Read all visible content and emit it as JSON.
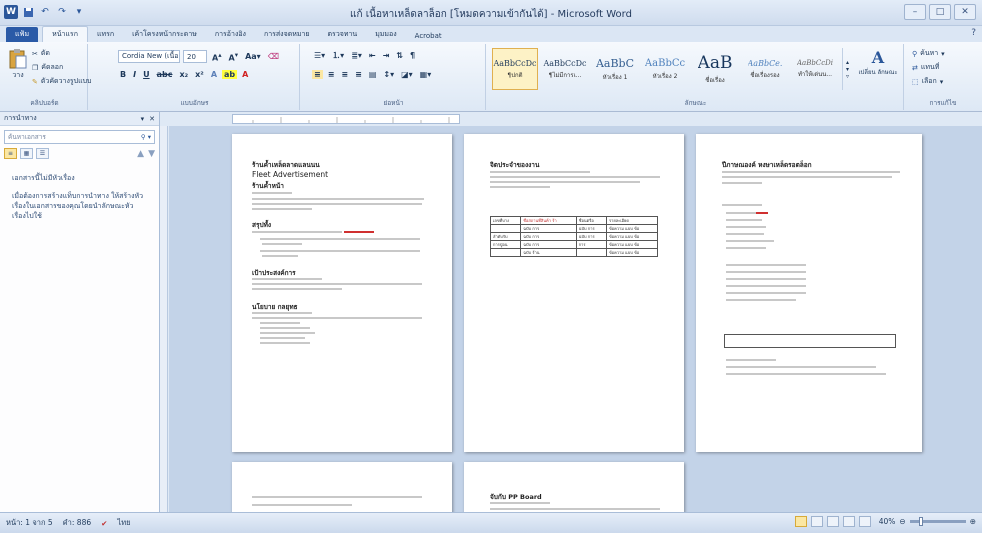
{
  "window": {
    "title": "แก้ เนื้อหาเหล็ดลาล็อก [โหมดความเข้ากันได้] - Microsoft Word",
    "controls": [
      "–",
      "□",
      "✕"
    ]
  },
  "qat": {
    "word_icon": "W",
    "save_icon": "save-icon",
    "undo_icon": "undo-icon",
    "redo_icon": "redo-icon"
  },
  "tabs": [
    "แฟ้ม",
    "หน้าแรก",
    "แทรก",
    "เค้าโครงหน้ากระดาษ",
    "การอ้างอิง",
    "การส่งจดหมาย",
    "ตรวจทาน",
    "มุมมอง",
    "Acrobat"
  ],
  "ribbon": {
    "clipboard": {
      "label": "คลิปบอร์ด",
      "paste": "วาง",
      "cut": "ตัด",
      "copy": "คัดลอก",
      "format_painter": "ตัวคัดวางรูปแบบ"
    },
    "font": {
      "label": "แบบอักษร",
      "font_name": "Cordia New (เนื้อ",
      "font_size": "20"
    },
    "paragraph": {
      "label": "ย่อหน้า"
    },
    "styles": {
      "label": "ลักษณะ",
      "items": [
        {
          "sample": "AaBbCcDc",
          "name": "¶ปกติ"
        },
        {
          "sample": "AaBbCcDc",
          "name": "¶ไม่มีการเ..."
        },
        {
          "sample": "AaBbC",
          "name": "หัวเรื่อง 1"
        },
        {
          "sample": "AaBbCc",
          "name": "หัวเรื่อง 2"
        },
        {
          "sample": "AaB",
          "name": "ชื่อเรื่อง"
        },
        {
          "sample": "AaBbCe.",
          "name": "ชื่อเรื่องรอง"
        },
        {
          "sample": "AaBbCcDi",
          "name": "ทำให้เด่นน..."
        }
      ],
      "change_styles": "เปลี่ยน ลักษณะ"
    },
    "editing": {
      "label": "การแก้ไข",
      "find": "ค้นหา",
      "replace": "แทนที่",
      "select": "เลือก"
    }
  },
  "nav_pane": {
    "title": "การนำทาง",
    "search_placeholder": "ค้นหาเอกสาร",
    "message_1": "เอกสารนี้ไม่มีหัวเรื่อง",
    "message_2": "เมื่อต้องการสร้างแท็บการนำทาง ให้สร้างหัวเรื่องในเอกสารของคุณโดยนำลักษณะหัวเรื่องไปใช้"
  },
  "pages": {
    "p1_title1": "ร้านค้ำเหล็ดลาดแลนนน",
    "p1_title2": "Fleet Advertisement",
    "p1_title3": "ร้านค้ำหน้า",
    "p1_s1": "สรุปทั้ง",
    "p1_s2": "เป้าประสงค์การ",
    "p1_s3": "นโยบาย กลยุทธ",
    "p2_title": "จิตประจำของงาน",
    "p4_title": "ปีภาษณองค์ หงษาเหล็ดรอตล็อก",
    "p5_title": "จับกับ PP Board"
  },
  "table_cells": [
    [
      "เลขที่บาง",
      "ชื่อสถานที่สินค้า ร้า",
      "ชื่อนตรือ",
      "รายละเอียด"
    ],
    [
      "",
      "ฉบับ การ",
      "ฉบับ การ",
      "ข้อความ แบบ ข้อ"
    ],
    [
      "ลำดับรับ",
      "ฉบับ การ",
      "ฉบับ การ",
      "ข้อความ แบบ ข้อ"
    ],
    [
      "การปู่อน",
      "ฉบับ การ",
      "การ",
      "ข้อความ แบบ ข้อ"
    ],
    [
      "",
      "ฉบับ ร้าน",
      "",
      "ข้อความ แบบ ข้อ"
    ]
  ],
  "status": {
    "page": "หน้า: 1 จาก 5",
    "words": "คำ: 886",
    "language": "ไทย",
    "zoom": "40%",
    "zoom_fraction": 0.4
  }
}
